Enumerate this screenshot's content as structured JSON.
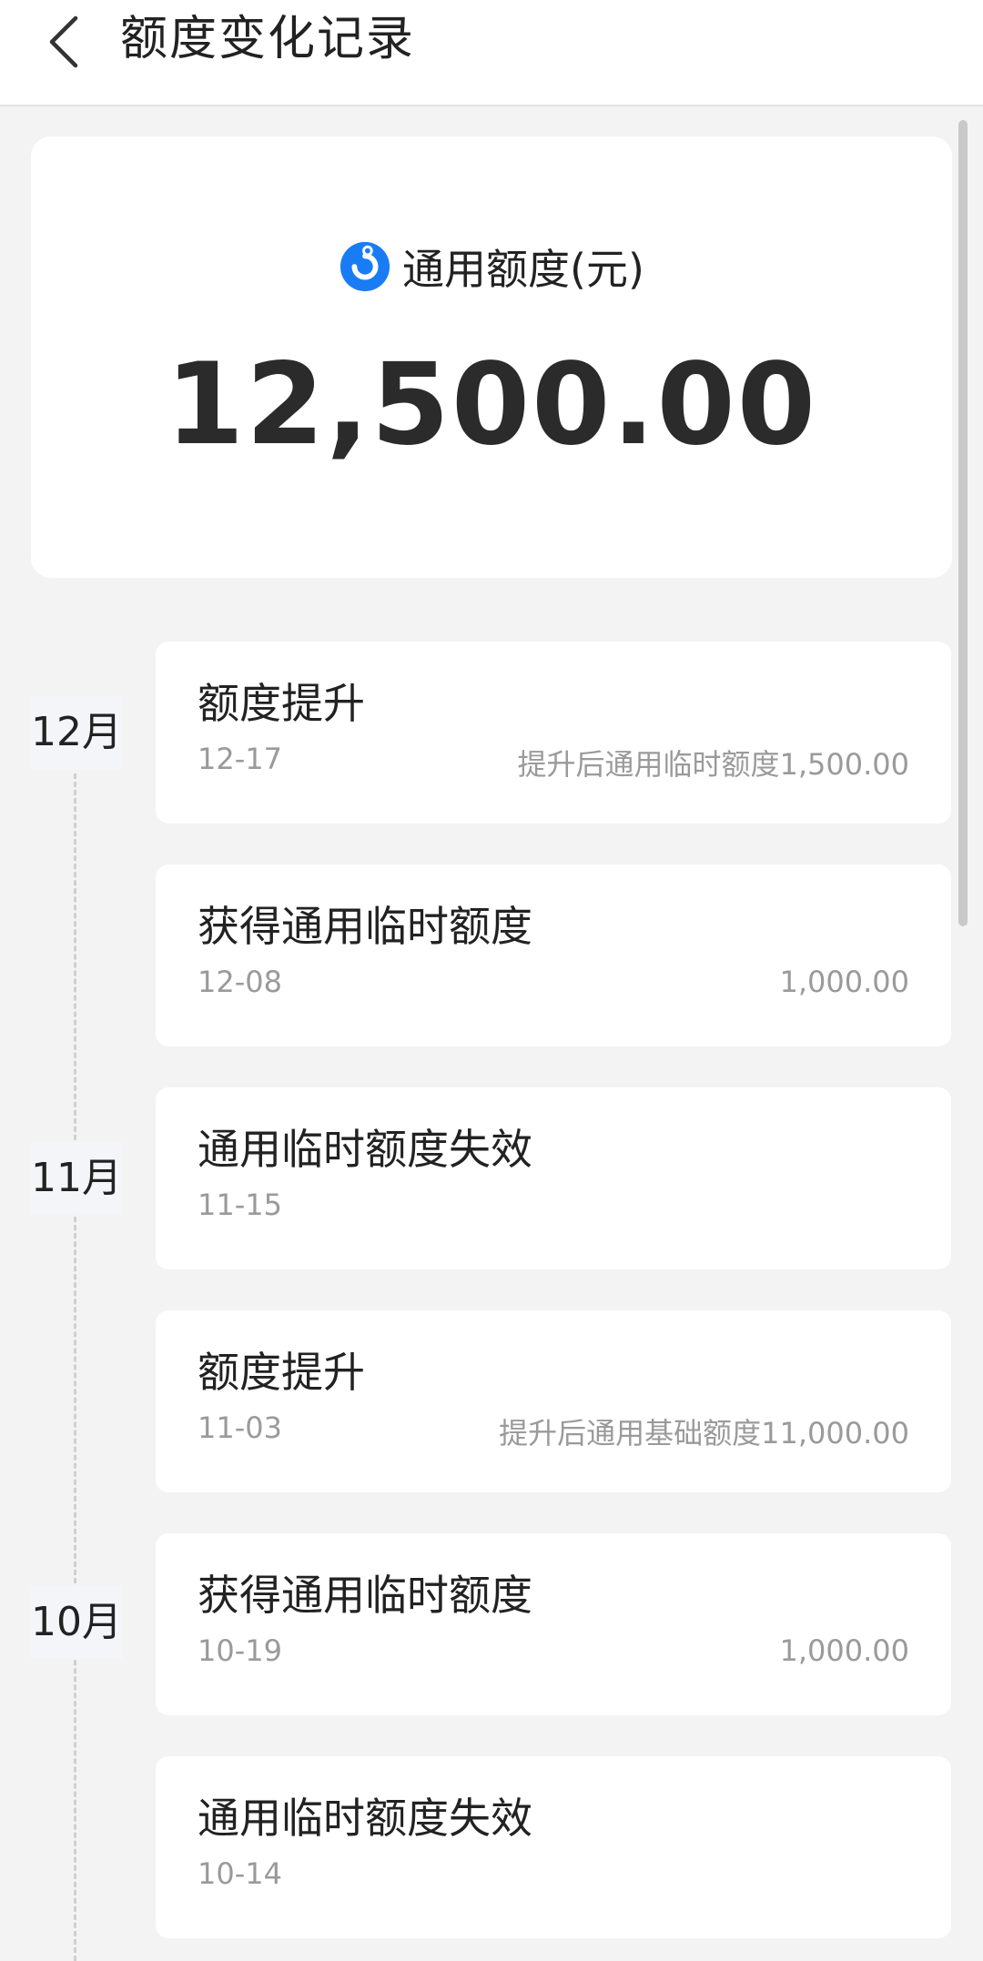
{
  "header": {
    "title": "额度变化记录",
    "back_icon": "chevron-left-icon"
  },
  "summary": {
    "icon": "quota-logo-icon",
    "label": "通用额度(元)",
    "amount": "12,500.00",
    "accent_color": "#1a7cf5"
  },
  "timeline": {
    "months": [
      "12月",
      "11月",
      "10月"
    ],
    "records": [
      {
        "title": "额度提升",
        "date": "12-17",
        "detail": "提升后通用临时额度1,500.00"
      },
      {
        "title": "获得通用临时额度",
        "date": "12-08",
        "detail": "1,000.00"
      },
      {
        "title": "通用临时额度失效",
        "date": "11-15",
        "detail": ""
      },
      {
        "title": "额度提升",
        "date": "11-03",
        "detail": "提升后通用基础额度11,000.00"
      },
      {
        "title": "获得通用临时额度",
        "date": "10-19",
        "detail": "1,000.00"
      },
      {
        "title": "通用临时额度失效",
        "date": "10-14",
        "detail": ""
      }
    ]
  }
}
